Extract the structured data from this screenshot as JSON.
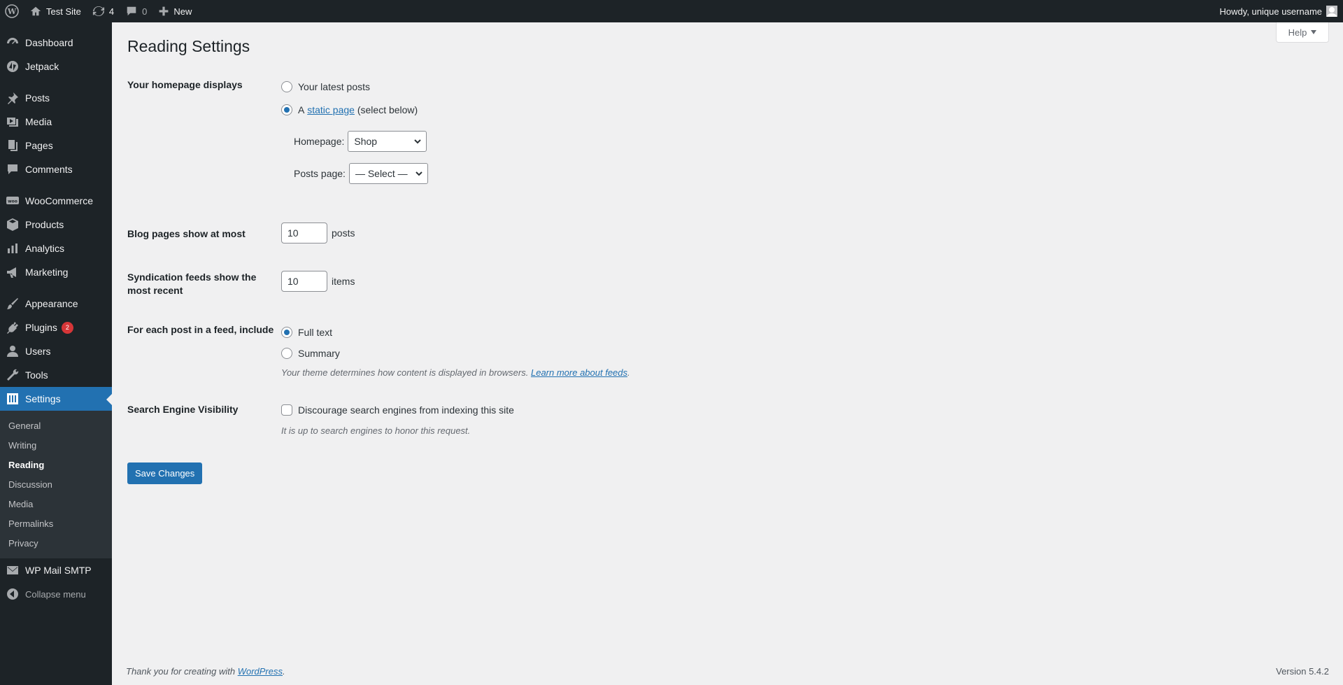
{
  "admin_bar": {
    "site_name": "Test Site",
    "updates_count": "4",
    "comments_count": "0",
    "new_label": "New",
    "greeting": "Howdy, unique username"
  },
  "sidebar": {
    "items": [
      {
        "label": "Dashboard",
        "icon": "dashboard-icon"
      },
      {
        "label": "Jetpack",
        "icon": "jetpack-icon"
      },
      {
        "label": "Posts",
        "icon": "pushpin-icon"
      },
      {
        "label": "Media",
        "icon": "media-icon"
      },
      {
        "label": "Pages",
        "icon": "pages-icon"
      },
      {
        "label": "Comments",
        "icon": "comment-icon"
      },
      {
        "label": "WooCommerce",
        "icon": "woocommerce-icon"
      },
      {
        "label": "Products",
        "icon": "archive-box-icon"
      },
      {
        "label": "Analytics",
        "icon": "bar-chart-icon"
      },
      {
        "label": "Marketing",
        "icon": "megaphone-icon"
      },
      {
        "label": "Appearance",
        "icon": "paintbrush-icon"
      },
      {
        "label": "Plugins",
        "icon": "plugin-icon",
        "badge": "2"
      },
      {
        "label": "Users",
        "icon": "user-icon"
      },
      {
        "label": "Tools",
        "icon": "wrench-icon"
      },
      {
        "label": "Settings",
        "icon": "settings-sliders-icon"
      }
    ],
    "settings_submenu": [
      "General",
      "Writing",
      "Reading",
      "Discussion",
      "Media",
      "Permalinks",
      "Privacy"
    ],
    "wp_mail_smtp": "WP Mail SMTP",
    "collapse_label": "Collapse menu"
  },
  "help_label": "Help",
  "page_title": "Reading Settings",
  "homepage_displays": {
    "label": "Your homepage displays",
    "option_latest": "Your latest posts",
    "option_static_prefix": "A",
    "option_static_link": "static page",
    "option_static_suffix": "(select below)",
    "homepage_label": "Homepage:",
    "homepage_value": "Shop",
    "posts_page_label": "Posts page:",
    "posts_page_value": "— Select —"
  },
  "blog_pages": {
    "label": "Blog pages show at most",
    "value": "10",
    "unit": "posts"
  },
  "syndication": {
    "label": "Syndication feeds show the most recent",
    "value": "10",
    "unit": "items"
  },
  "feed_include": {
    "label": "For each post in a feed, include",
    "option_full": "Full text",
    "option_summary": "Summary",
    "note": "Your theme determines how content is displayed in browsers.",
    "note_link": "Learn more about feeds"
  },
  "search_visibility": {
    "label": "Search Engine Visibility",
    "checkbox_label": "Discourage search engines from indexing this site",
    "note": "It is up to search engines to honor this request."
  },
  "save_label": "Save Changes",
  "footer": {
    "thanks_prefix": "Thank you for creating with",
    "thanks_link": "WordPress",
    "version": "Version 5.4.2"
  },
  "colors": {
    "accent": "#2271b1",
    "sidebar_bg": "#1d2327",
    "badge": "#d63638"
  }
}
